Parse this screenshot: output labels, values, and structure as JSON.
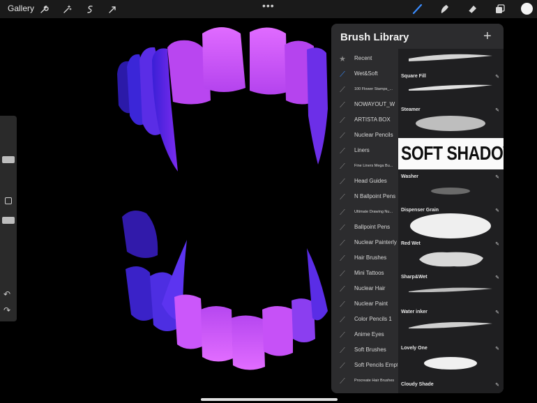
{
  "topbar": {
    "gallery_label": "Gallery",
    "more_label": "•••",
    "icons": [
      "wrench-icon",
      "magic-wand-icon",
      "selection-icon",
      "transform-icon",
      "brush-icon",
      "smudge-icon",
      "eraser-icon",
      "layers-icon",
      "color-icon"
    ],
    "accent_color": "#3a8dff",
    "current_color": "#f4f4f4"
  },
  "panel": {
    "title": "Brush Library",
    "add_label": "+",
    "sets": [
      {
        "label": "Recent",
        "icon": "star-icon"
      },
      {
        "label": "Wet&Soft",
        "icon": "brush-set-icon",
        "active": true
      },
      {
        "label": "100 Flower Stamps_...",
        "icon": "brush-set-icon"
      },
      {
        "label": "NOWAYOUT_W",
        "icon": "brush-set-icon"
      },
      {
        "label": "ARTISTA BOX",
        "icon": "brush-set-icon"
      },
      {
        "label": "Nuclear Pencils",
        "icon": "brush-set-icon"
      },
      {
        "label": "Liners",
        "icon": "brush-set-icon"
      },
      {
        "label": "Fine Liners Mega Bu...",
        "icon": "brush-set-icon"
      },
      {
        "label": "Head Guides",
        "icon": "brush-set-icon"
      },
      {
        "label": "N Ballpoint Pens",
        "icon": "brush-set-icon"
      },
      {
        "label": "Ultimate Drawing Nu...",
        "icon": "brush-set-icon"
      },
      {
        "label": "Ballpoint Pens",
        "icon": "brush-set-icon"
      },
      {
        "label": "Nuclear Painterly",
        "icon": "brush-set-icon"
      },
      {
        "label": "Hair Brushes",
        "icon": "brush-set-icon"
      },
      {
        "label": "Mini Tattoos",
        "icon": "brush-set-icon"
      },
      {
        "label": "Nuclear Hair",
        "icon": "brush-set-icon"
      },
      {
        "label": "Nuclear Paint",
        "icon": "brush-set-icon"
      },
      {
        "label": "Color Pencils 1",
        "icon": "brush-set-icon"
      },
      {
        "label": "Anime Eyes",
        "icon": "brush-set-icon"
      },
      {
        "label": "Soft Brushes",
        "icon": "brush-set-icon"
      },
      {
        "label": "Soft Pencils Empty",
        "icon": "brush-set-icon"
      },
      {
        "label": "Procreate Hair Brushes",
        "icon": "brush-set-icon"
      }
    ],
    "brushes": [
      {
        "name": "Square Fill"
      },
      {
        "name": "Steamer"
      },
      {
        "name": "Washer"
      },
      {
        "name": "Dispenser Grain"
      },
      {
        "name": "Red Wet"
      },
      {
        "name": "Sharp&Wet"
      },
      {
        "name": "Water inker"
      },
      {
        "name": "Lovely One"
      },
      {
        "name": "Cloudy Shade"
      }
    ],
    "soft_shadow_label": "SOFT SHADOW",
    "edit_icon": "pencil-edit-icon"
  },
  "sidebar": {
    "undo_icon": "undo-icon",
    "redo_icon": "redo-icon"
  }
}
